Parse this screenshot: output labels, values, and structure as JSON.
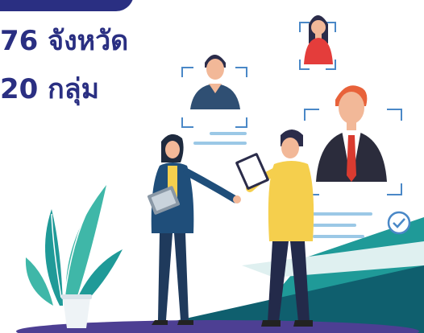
{
  "banner": {
    "headline_line_1": "76 จังหวัด",
    "headline_line_2": "20 กลุ่ม"
  },
  "illustration": {
    "icons": [
      "profile-card-woman-icon",
      "profile-card-man-icon",
      "profile-card-manager-icon",
      "checkmark-badge-icon",
      "plant-icon"
    ]
  },
  "colors": {
    "brand_navy": "#2a2f82",
    "teal": "#1f9a98",
    "dark_teal": "#0f5f6e",
    "light_blue": "#9bc8e6",
    "frame_blue": "#4a88c7",
    "yellow": "#f5cf4d",
    "red_tie": "#d93b30",
    "floor_purple": "#4d3f93"
  }
}
